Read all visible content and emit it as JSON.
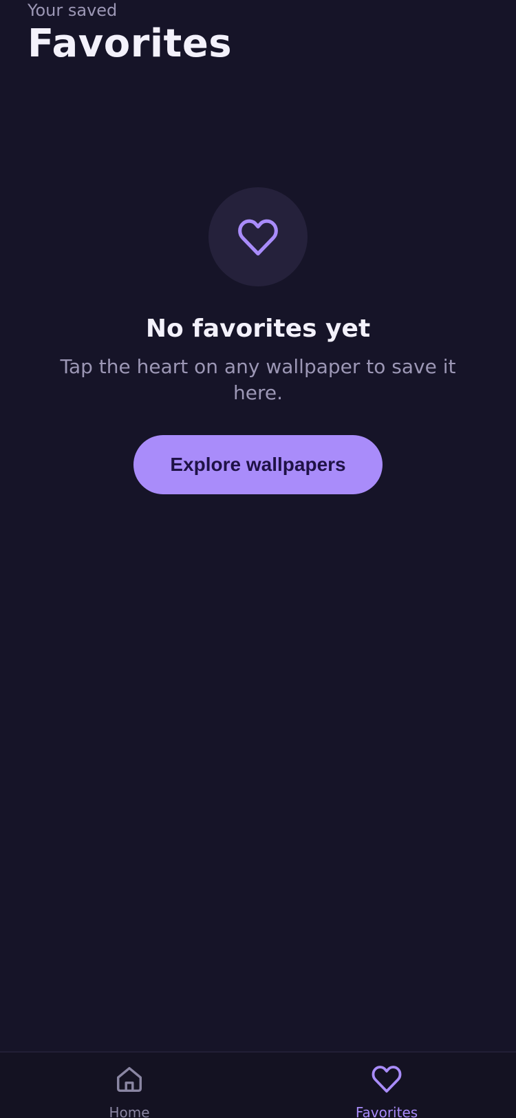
{
  "header": {
    "subtitle": "Your saved",
    "title": "Favorites"
  },
  "empty_state": {
    "icon": "heart-icon",
    "title": "No favorites yet",
    "description": "Tap the heart on any wallpaper to save it here.",
    "button_label": "Explore wallpapers"
  },
  "bottom_nav": {
    "items": [
      {
        "label": "Home",
        "icon": "home-icon",
        "active": false
      },
      {
        "label": "Favorites",
        "icon": "heart-icon",
        "active": true
      }
    ]
  },
  "colors": {
    "background": "#161428",
    "accent": "#a98cfa",
    "button_text": "#1f1246",
    "muted_text": "#9c97b5",
    "primary_text": "#f3f1fb"
  }
}
